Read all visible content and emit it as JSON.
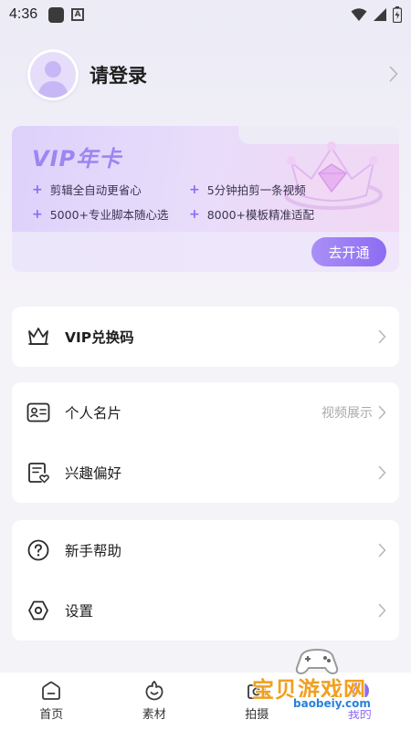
{
  "status_bar": {
    "time": "4:36",
    "a_icon": "A"
  },
  "profile": {
    "login_label": "请登录"
  },
  "vip": {
    "title": "VIP年卡",
    "perks": [
      "剪辑全自动更省心",
      "5分钟拍剪一条视频",
      "5000+专业脚本随心选",
      "8000+模板精准适配"
    ],
    "open_button": "去开通",
    "accent": "#8a6cf3"
  },
  "menu": {
    "redeem": "VIP兑换码",
    "card_label": "个人名片",
    "card_hint": "视频展示",
    "interests": "兴趣偏好",
    "help": "新手帮助",
    "settings": "设置"
  },
  "nav": {
    "items": [
      {
        "label": "首页",
        "icon": "home-icon"
      },
      {
        "label": "素材",
        "icon": "material-icon"
      },
      {
        "label": "拍摄",
        "icon": "camera-icon"
      },
      {
        "label": "我的",
        "icon": "profile-icon",
        "active": true
      }
    ]
  },
  "watermark": {
    "text": "宝贝游戏网",
    "url": "baobeiy.com"
  }
}
